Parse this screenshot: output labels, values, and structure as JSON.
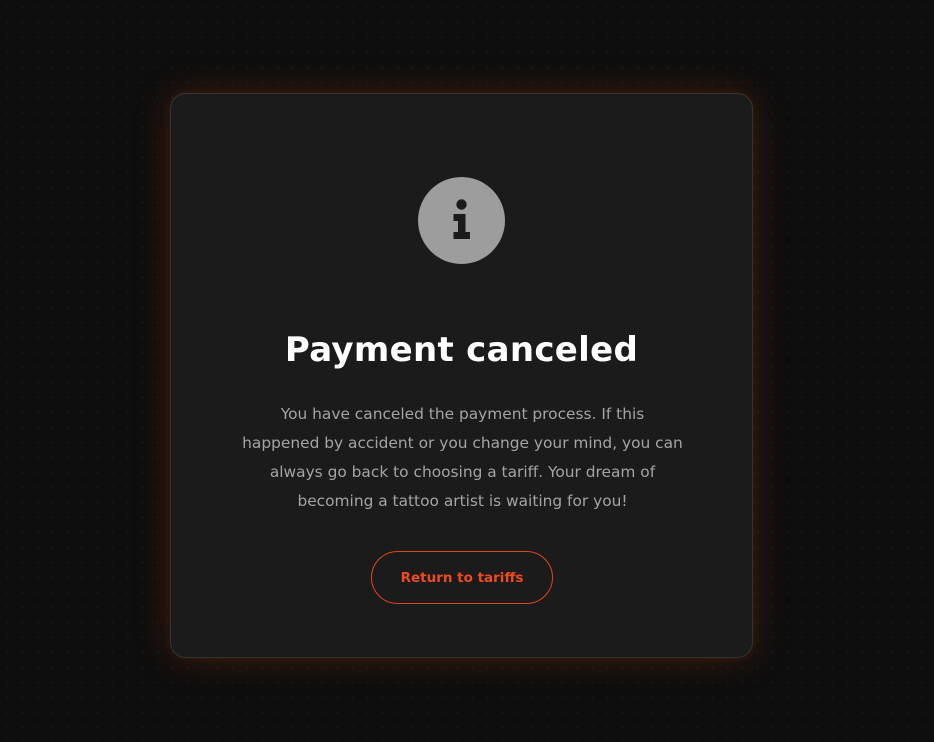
{
  "dialog": {
    "icon": "info-icon",
    "title": "Payment canceled",
    "message": "You have canceled the payment process. If this happened by accident or you change your mind, you can always go back to choosing a tariff. Your dream of becoming a tattoo artist is waiting for you!",
    "button_label": "Return to tariffs"
  },
  "colors": {
    "background": "#0e0e0e",
    "card": "#1b1b1b",
    "icon_circle": "#9d9d9d",
    "accent": "#ef4a1f",
    "title": "#ffffff",
    "message": "#a4a4a4"
  }
}
